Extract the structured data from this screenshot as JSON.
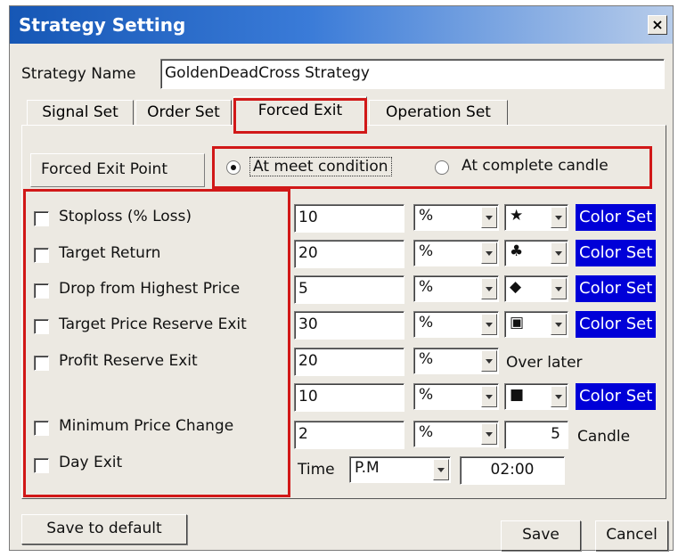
{
  "window": {
    "title": "Strategy Setting",
    "close_glyph": "×"
  },
  "strategy_name": {
    "label": "Strategy Name",
    "value": "GoldenDeadCross Strategy"
  },
  "tabs": [
    {
      "label": "Signal Set"
    },
    {
      "label": "Order Set"
    },
    {
      "label": "Forced  Exit"
    },
    {
      "label": "Operation Set"
    }
  ],
  "forced_exit_point": {
    "label": "Forced Exit Point",
    "option_condition": "At meet condition",
    "option_candle": "At complete candle",
    "selected": "At meet condition"
  },
  "rows": [
    {
      "label": "Stoploss (% Loss)",
      "value": "10",
      "unit": "%",
      "symbol": "★",
      "color_set": "Color Set"
    },
    {
      "label": "Target Return",
      "value": "20",
      "unit": "%",
      "symbol": "♣",
      "color_set": "Color Set"
    },
    {
      "label": "Drop from Highest Price",
      "value": "5",
      "unit": "%",
      "symbol": "◆",
      "color_set": "Color Set"
    },
    {
      "label": "Target Price Reserve Exit",
      "value": "30",
      "unit": "%",
      "symbol": "▣",
      "color_set": "Color Set"
    },
    {
      "label": "Profit Reserve Exit",
      "value": "20",
      "unit": "%",
      "suffix": "Over later"
    },
    {
      "value": "10",
      "unit": "%",
      "symbol": "■",
      "color_set": "Color Set"
    },
    {
      "label": "Minimum Price Change",
      "value": "2",
      "unit": "%",
      "candle_value": "5",
      "candle_label": "Candle"
    },
    {
      "label": "Day Exit"
    }
  ],
  "time": {
    "label": "Time",
    "ampm": "P.M",
    "value": "02:00"
  },
  "buttons": {
    "save_default": "Save to default",
    "save": "Save",
    "cancel": "Cancel"
  },
  "colors": {
    "highlight_red": "#d11818",
    "color_set_blue": "#0000d8",
    "titlebar_blue": "#1657b5"
  }
}
